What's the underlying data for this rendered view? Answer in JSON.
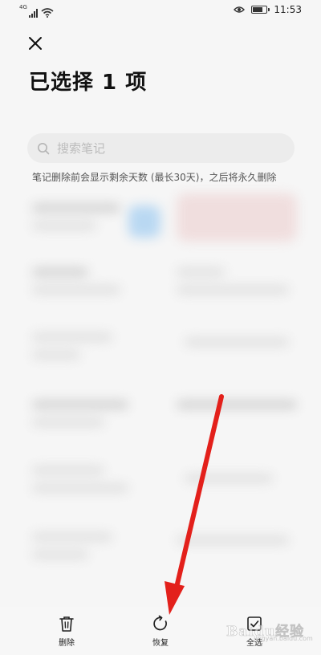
{
  "status_bar": {
    "network": "4G",
    "signal_bars": 4,
    "time": "11:53",
    "battery_level": 0.8,
    "icons": [
      "signal-icon",
      "wifi-icon",
      "eye-icon",
      "battery-icon"
    ]
  },
  "header": {
    "close_icon": "close-icon",
    "title": "已选择 1 项"
  },
  "search": {
    "icon": "search-icon",
    "placeholder": "搜索笔记",
    "value": ""
  },
  "hint": "笔记删除前会显示剩余天数 (最长30天)，之后将永久删除",
  "toolbar": {
    "items": [
      {
        "label": "删除",
        "icon": "trash-icon"
      },
      {
        "label": "恢复",
        "icon": "restore-icon"
      },
      {
        "label": "全选",
        "icon": "select-all-icon"
      }
    ]
  },
  "watermark": {
    "text": "Baidu经验",
    "sub": "jingyan.baidu.com"
  },
  "colors": {
    "background": "#f6f6f6",
    "search_background": "#ececec",
    "annotation_arrow": "#e3201b"
  }
}
